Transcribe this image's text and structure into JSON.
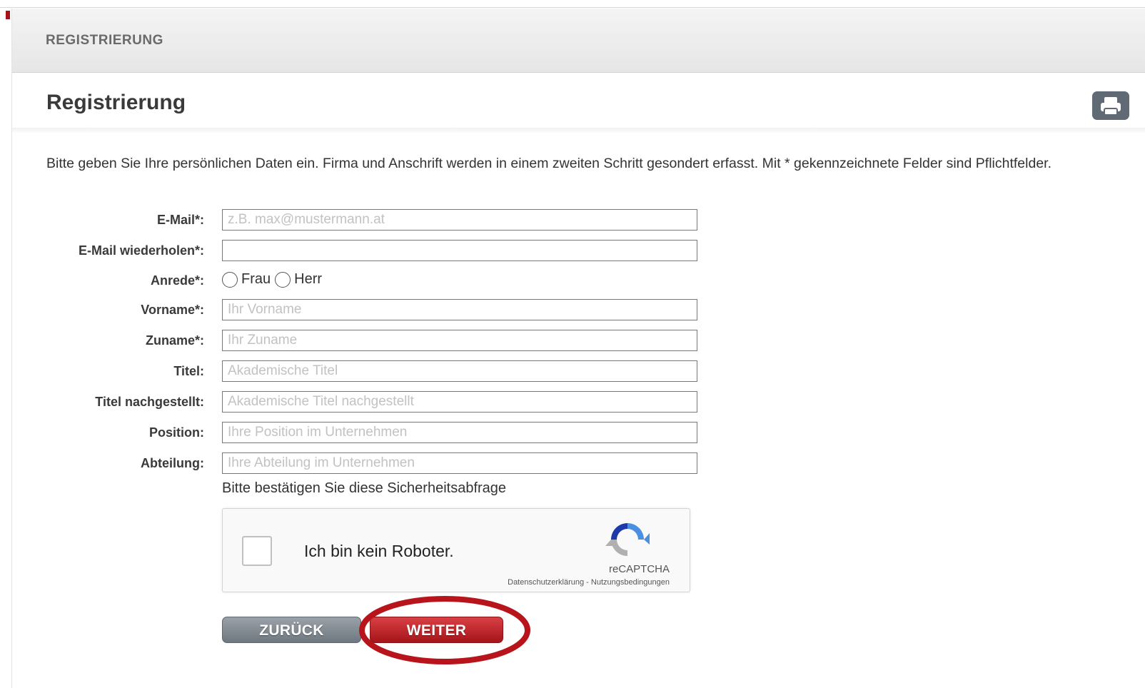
{
  "header": {
    "title": "REGISTRIERUNG"
  },
  "page": {
    "title": "Registrierung",
    "print_icon": "print-icon"
  },
  "intro": "Bitte geben Sie Ihre persönlichen Daten ein. Firma und Anschrift werden in einem zweiten Schritt gesondert erfasst. Mit * gekennzeichnete Felder sind Pflichtfelder.",
  "form": {
    "email": {
      "label": "E-Mail*:",
      "placeholder": "z.B. max@mustermann.at",
      "value": ""
    },
    "email_repeat": {
      "label": "E-Mail wiederholen*:",
      "placeholder": "",
      "value": ""
    },
    "salutation": {
      "label": "Anrede*:",
      "options": [
        "Frau",
        "Herr"
      ]
    },
    "firstname": {
      "label": "Vorname*:",
      "placeholder": "Ihr Vorname",
      "value": ""
    },
    "lastname": {
      "label": "Zuname*:",
      "placeholder": "Ihr Zuname",
      "value": ""
    },
    "title": {
      "label": "Titel:",
      "placeholder": "Akademische Titel",
      "value": ""
    },
    "title_suffix": {
      "label": "Titel nachgestellt:",
      "placeholder": "Akademische Titel nachgestellt",
      "value": ""
    },
    "position": {
      "label": "Position:",
      "placeholder": "Ihre Position im Unternehmen",
      "value": ""
    },
    "department": {
      "label": "Abteilung:",
      "placeholder": "Ihre Abteilung im Unternehmen",
      "value": ""
    }
  },
  "captcha": {
    "caption": "Bitte bestätigen Sie diese Sicherheitsabfrage",
    "checkbox_label": "Ich bin kein Roboter.",
    "brand": "reCAPTCHA",
    "links": "Datenschutzerklärung - Nutzungsbedingungen",
    "checked": false
  },
  "buttons": {
    "back": "ZURÜCK",
    "next": "WEITER"
  },
  "colors": {
    "brand_red": "#a3141b",
    "button_gray": "#7d858c",
    "highlight": "#b8141c"
  }
}
